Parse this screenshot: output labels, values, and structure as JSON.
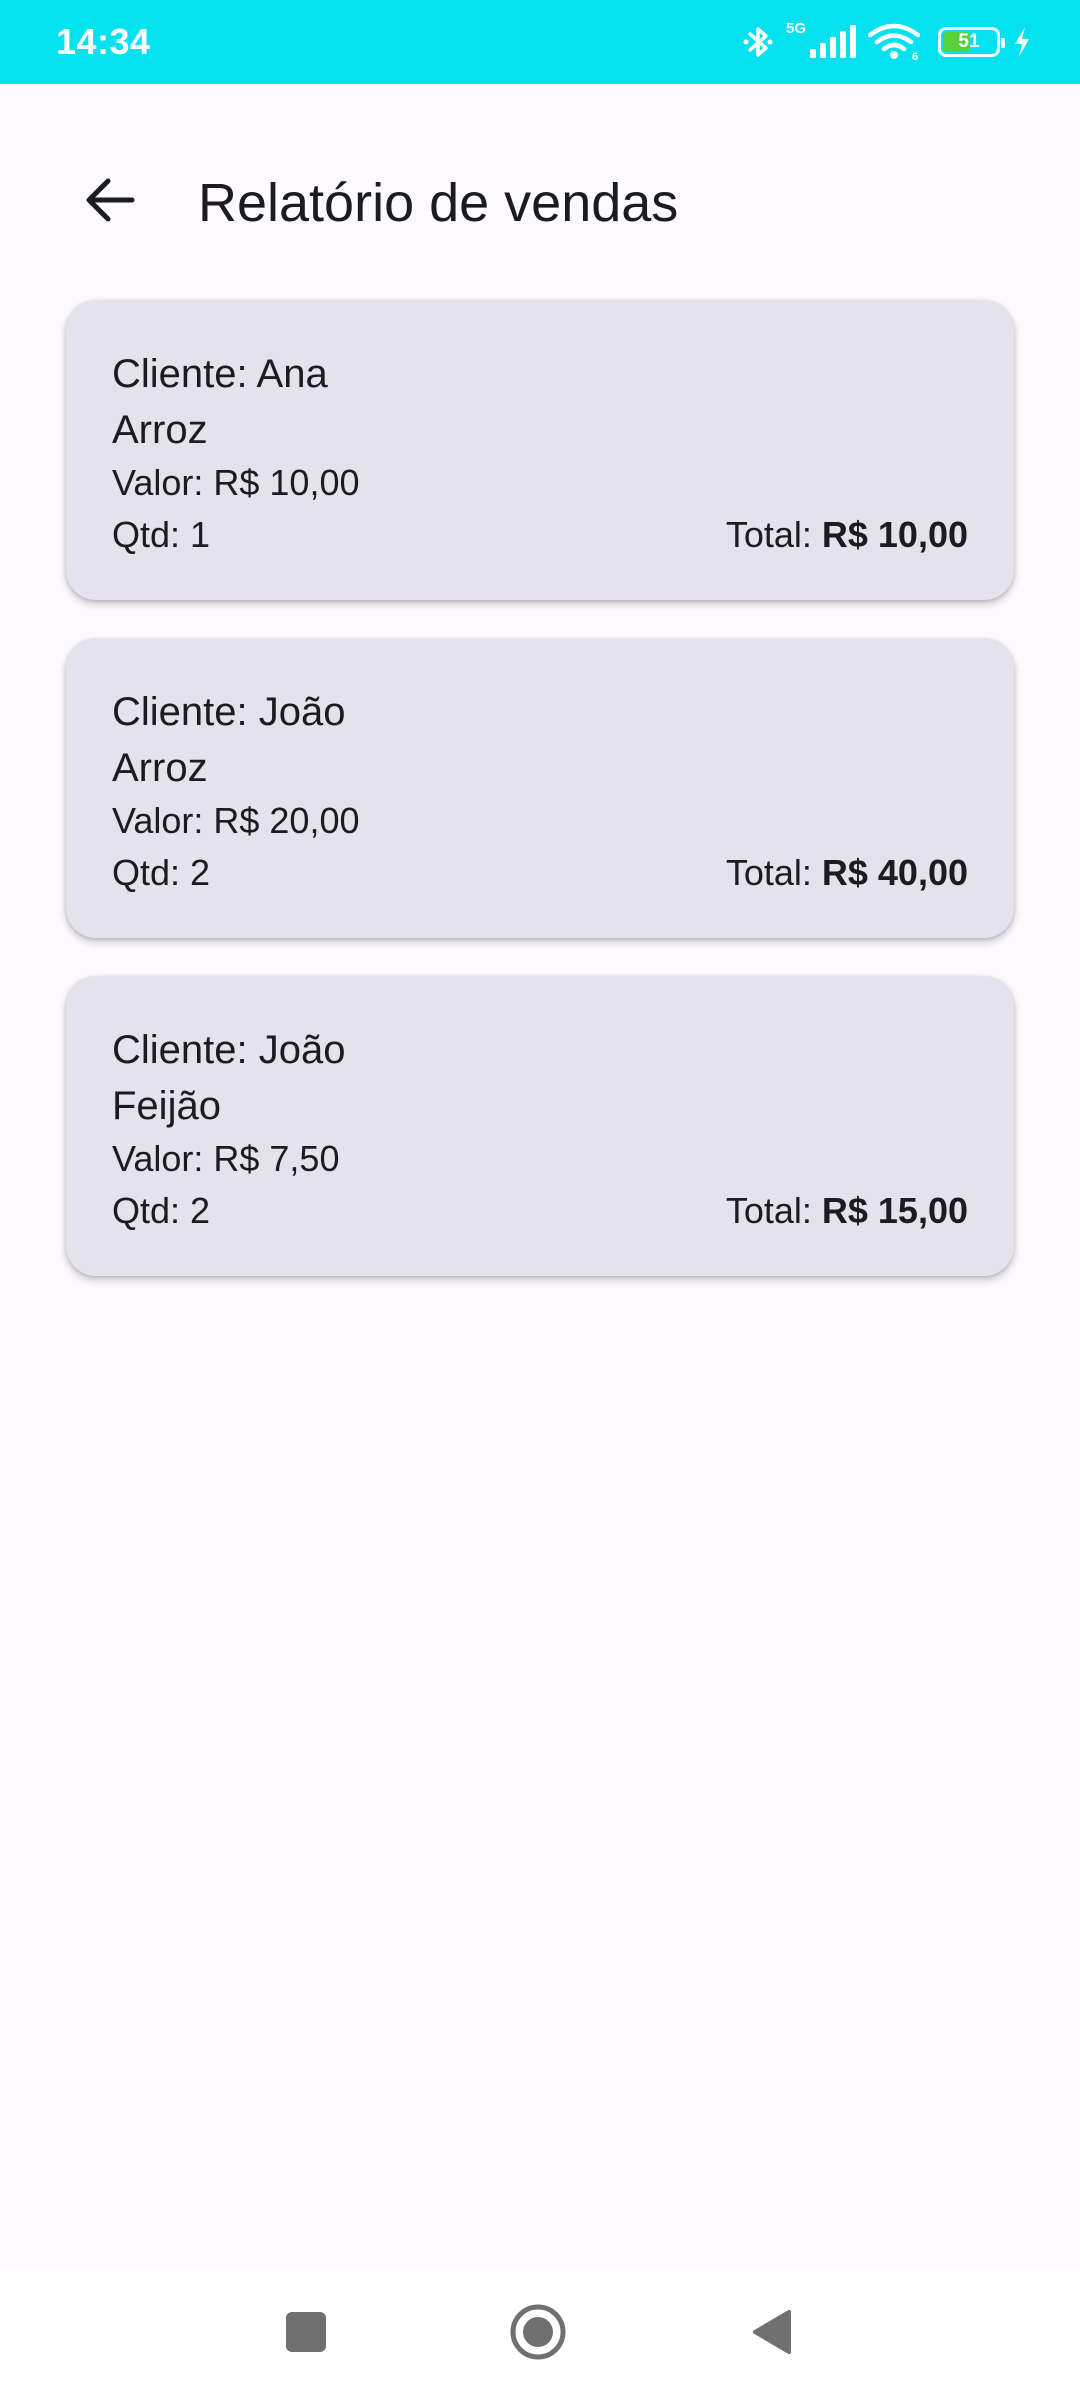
{
  "status_bar": {
    "time": "14:34",
    "network_label": "5G",
    "battery_level": "51",
    "battery_fraction": 0.51,
    "icons": [
      "bluetooth-icon",
      "signal-icon",
      "wifi-icon",
      "battery-icon",
      "charging-icon"
    ],
    "background_color": "#06e1f0"
  },
  "app_bar": {
    "title": "Relatório de vendas",
    "back_icon": "arrow-back-icon"
  },
  "sales": [
    {
      "client": "Cliente: Ana",
      "product": "Arroz",
      "value": "Valor: R$ 10,00",
      "qty": "Qtd: 1",
      "total_label": "Total: ",
      "total_amount": "R$ 10,00"
    },
    {
      "client": "Cliente: João",
      "product": "Arroz",
      "value": "Valor: R$ 20,00",
      "qty": "Qtd: 2",
      "total_label": "Total: ",
      "total_amount": "R$ 40,00"
    },
    {
      "client": "Cliente: João",
      "product": "Feijão",
      "value": "Valor: R$ 7,50",
      "qty": "Qtd: 2",
      "total_label": "Total: ",
      "total_amount": "R$ 15,00"
    }
  ],
  "nav_bar": {
    "buttons": [
      "recents-square-icon",
      "home-circle-icon",
      "back-triangle-icon"
    ]
  },
  "colors": {
    "background": "#fcfaff",
    "card": "#e4e2ec",
    "text": "#1c1b22"
  }
}
